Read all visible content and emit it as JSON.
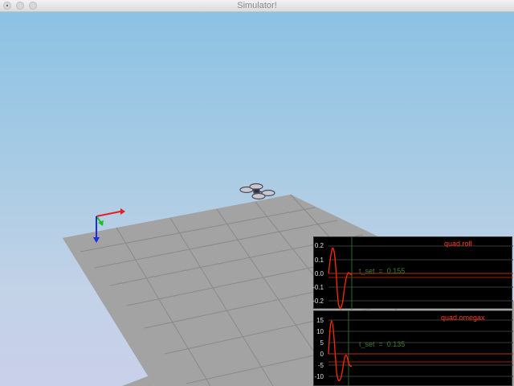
{
  "window": {
    "title": "Simulator!"
  },
  "plots": [
    {
      "title": "quad.roll",
      "tset_label": "t_set  =  0.155",
      "yticks": [
        "0.2",
        "0.1",
        "0.0",
        "-0.1",
        "-0.2"
      ],
      "colors": {
        "signal": "#ff2a00",
        "target": "#ff2a00",
        "settle": "#2e6b2e",
        "grid": "#3a3a3a"
      }
    },
    {
      "title": "quad.omegax",
      "tset_label": "t_set  =  0.135",
      "yticks": [
        "15",
        "10",
        "5",
        "0",
        "-5",
        "-10"
      ],
      "colors": {
        "signal": "#ff2a00",
        "target": "#ff2a00",
        "settle": "#2e6b2e",
        "grid": "#3a3a3a"
      }
    }
  ],
  "scene": {
    "axis_colors": {
      "x": "#e02020",
      "y": "#20c020",
      "z": "#1a30e0"
    },
    "ground_color": "#a3a3a3"
  }
}
